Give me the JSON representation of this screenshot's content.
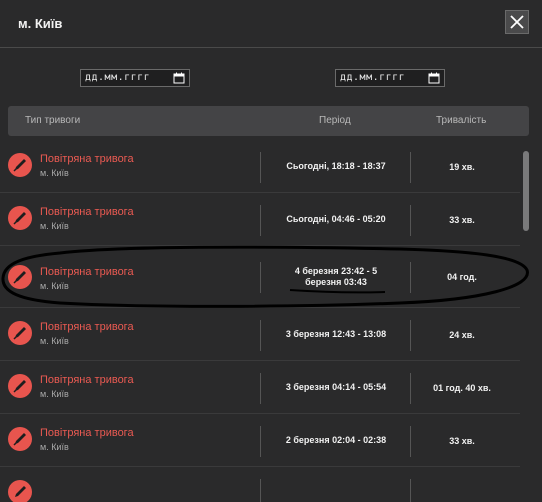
{
  "header": {
    "title": "м. Київ",
    "close_label": "close"
  },
  "filters": {
    "date_from": {
      "placeholder": "дд.мм.гггг"
    },
    "date_to": {
      "placeholder": "дд.мм.гггг"
    }
  },
  "table": {
    "columns": [
      "Тип тривоги",
      "Період",
      "Тривалість"
    ],
    "rows": [
      {
        "type": "Повітряна тривога",
        "city": "м. Київ",
        "period": "Сьогодні, 18:18 - 18:37",
        "duration": "19 хв."
      },
      {
        "type": "Повітряна тривога",
        "city": "м. Київ",
        "period": "Сьогодні, 04:46 - 05:20",
        "duration": "33 хв."
      },
      {
        "type": "Повітряна тривога",
        "city": "м. Київ",
        "period": "4 березня 23:42 - 5 березня 03:43",
        "duration": "04 год."
      },
      {
        "type": "Повітряна тривога",
        "city": "м. Київ",
        "period": "3 березня 12:43 - 13:08",
        "duration": "24 хв."
      },
      {
        "type": "Повітряна тривога",
        "city": "м. Київ",
        "period": "3 березня 04:14 - 05:54",
        "duration": "01 год. 40 хв."
      },
      {
        "type": "Повітряна тривога",
        "city": "м. Київ",
        "period": "2 березня 02:04 - 02:38",
        "duration": "33 хв."
      }
    ]
  },
  "colors": {
    "accent": "#ea5a52",
    "background": "#2a2a2b",
    "header_row": "#444446"
  },
  "icons": {
    "alert": "rocket-icon",
    "calendar": "calendar-icon",
    "close": "close-icon"
  }
}
